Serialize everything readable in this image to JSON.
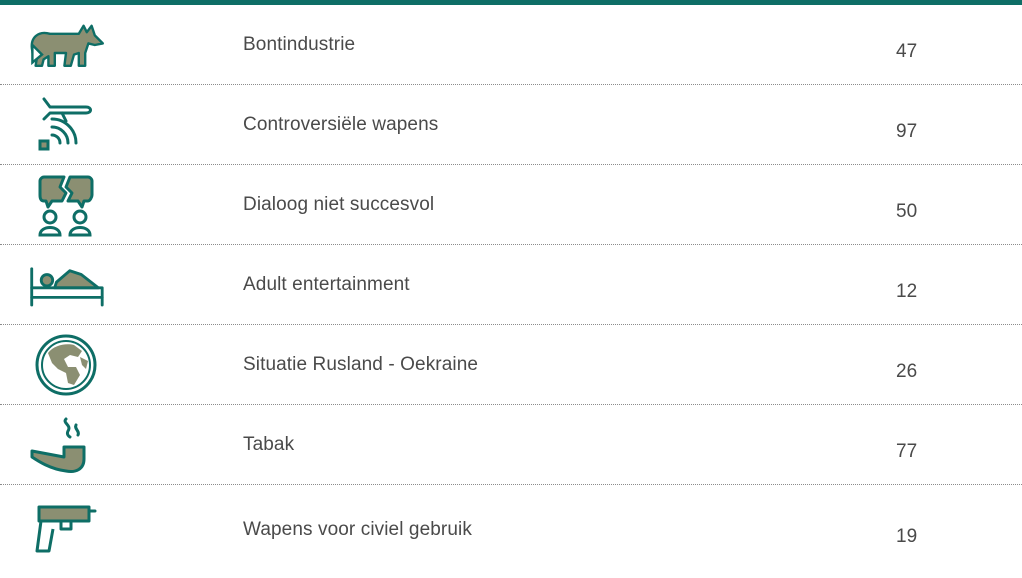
{
  "colors": {
    "accent": "#0e6e66",
    "icon_fill": "#8b8f72"
  },
  "rows": [
    {
      "icon": "fox-icon",
      "label": "Bontindustrie",
      "value": "47"
    },
    {
      "icon": "drone-icon",
      "label": "Controversiële wapens",
      "value": "97"
    },
    {
      "icon": "broken-dialogue-icon",
      "label": "Dialoog niet succesvol",
      "value": "50"
    },
    {
      "icon": "bed-icon",
      "label": "Adult entertainment",
      "value": "12"
    },
    {
      "icon": "globe-icon",
      "label": "Situatie Rusland - Oekraine",
      "value": "26"
    },
    {
      "icon": "pipe-icon",
      "label": "Tabak",
      "value": "77"
    },
    {
      "icon": "pistol-icon",
      "label": "Wapens voor civiel gebruik",
      "value": "19"
    }
  ]
}
